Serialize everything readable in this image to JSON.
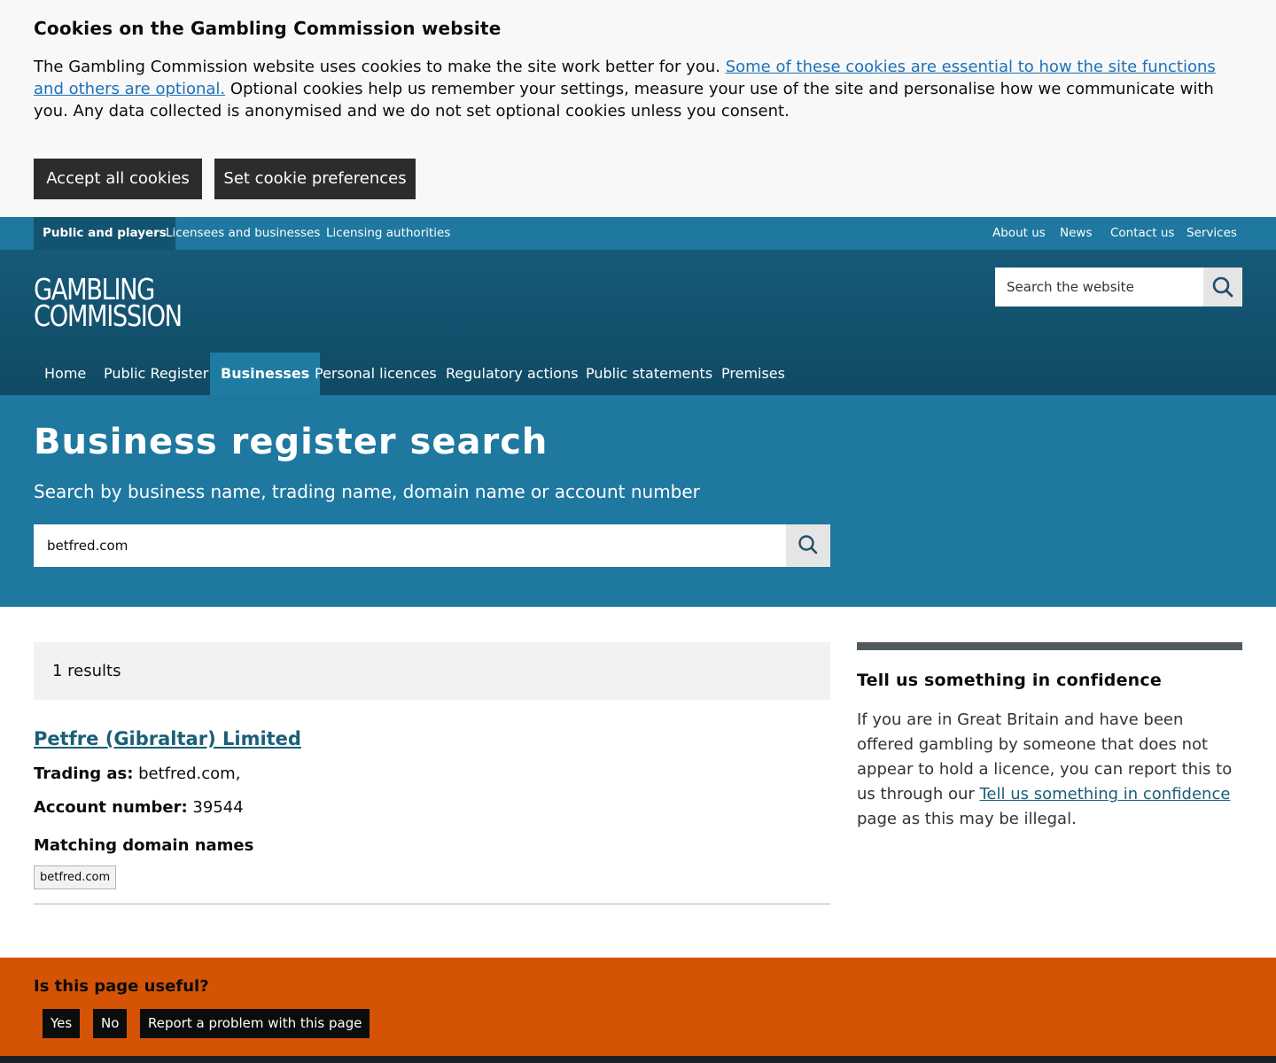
{
  "cookie_banner": {
    "title": "Cookies on the Gambling Commission website",
    "text_before": "The Gambling Commission website uses cookies to make the site work better for you. ",
    "link": "Some of these cookies are essential to how the site functions and others are optional.",
    "text_after": " Optional cookies help us remember your settings, measure your use of the site and personalise how we communicate with you. Any data collected is anonymised and we do not set optional cookies unless you consent.",
    "accept_label": "Accept all cookies",
    "preferences_label": "Set cookie preferences"
  },
  "topbar": {
    "left": [
      "Public and players",
      "Licensees and businesses",
      "Licensing authorities"
    ],
    "right": [
      "About us",
      "News",
      "Contact us",
      "Services"
    ]
  },
  "header": {
    "logo_line1": "GAMBLING",
    "logo_line2": "COMMISSION",
    "search_placeholder": "Search the website"
  },
  "main_nav": [
    "Home",
    "Public Register",
    "Businesses",
    "Personal licences",
    "Regulatory actions",
    "Public statements",
    "Premises"
  ],
  "hero": {
    "title": "Business register search",
    "subtitle": "Search by business name, trading name, domain name or account number",
    "search_value": "betfred.com"
  },
  "results": {
    "count_text": "1 results",
    "items": [
      {
        "name": "Petfre (Gibraltar) Limited",
        "trading_label": "Trading as:",
        "trading_value": " betfred.com,",
        "account_label": "Account number:",
        "account_value": " 39544",
        "domains_heading": "Matching domain names",
        "domains": [
          "betfred.com"
        ]
      }
    ]
  },
  "sidebar": {
    "title": "Tell us something in confidence",
    "text_before": "If you are in Great Britain and have been offered gambling by someone that does not appear to hold a licence, you can report this to us through our ",
    "link": "Tell us something in confidence",
    "text_after": " page as this may be illegal."
  },
  "feedback": {
    "question": "Is this page useful?",
    "yes": "Yes",
    "no": "No",
    "report": "Report a problem with this page"
  },
  "colors": {
    "topbar": "#1e78a0",
    "header": "#165a78",
    "hero": "#1e78a0",
    "feedback": "#d55305",
    "link": "#1d70b8"
  },
  "icons": [
    "search-icon"
  ]
}
